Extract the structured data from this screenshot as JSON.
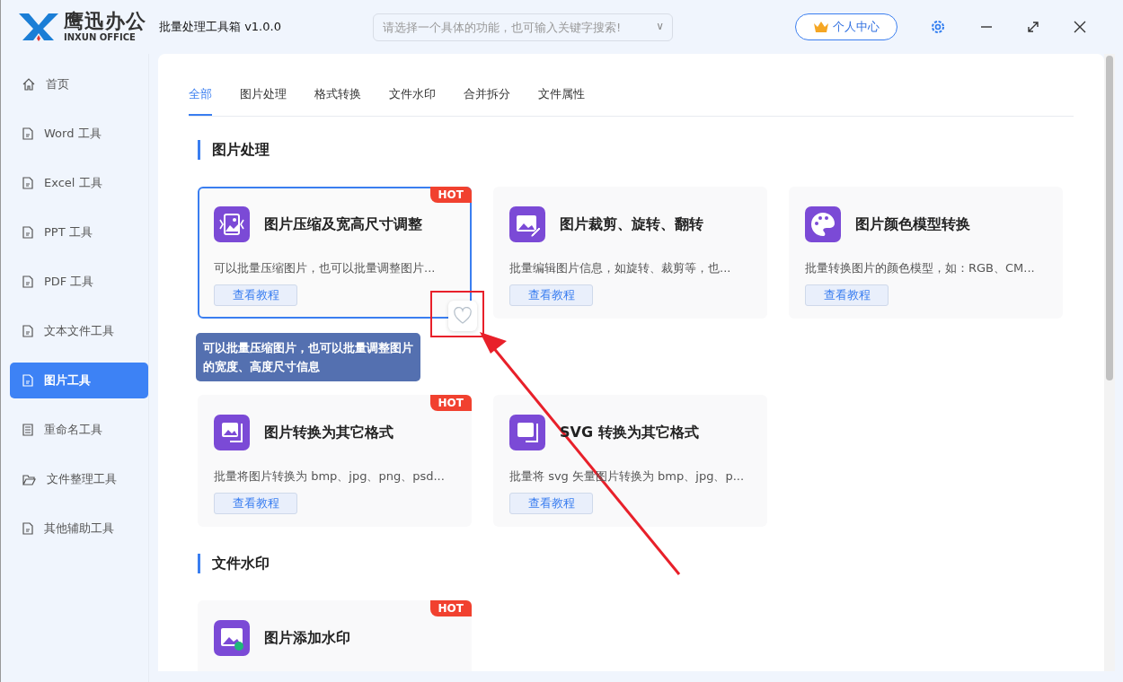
{
  "app": {
    "brand": "鹰迅办公",
    "brand_sub": "INXUN OFFICE",
    "title": "批量处理工具箱 v1.0.0"
  },
  "search": {
    "placeholder": "请选择一个具体的功能，也可输入关键字搜索!",
    "caret": "∨"
  },
  "user_button": "个人中心",
  "sidebar": {
    "items": [
      {
        "label": "首页",
        "kind": "home",
        "selected": false
      },
      {
        "label": "Word 工具",
        "kind": "file",
        "selected": false
      },
      {
        "label": "Excel 工具",
        "kind": "file",
        "selected": false
      },
      {
        "label": "PPT 工具",
        "kind": "file",
        "selected": false
      },
      {
        "label": "PDF 工具",
        "kind": "file",
        "selected": false
      },
      {
        "label": "文本文件工具",
        "kind": "file",
        "selected": false
      },
      {
        "label": "图片工具",
        "kind": "file",
        "selected": true
      },
      {
        "label": "重命名工具",
        "kind": "list",
        "selected": false
      },
      {
        "label": "文件整理工具",
        "kind": "folder",
        "selected": false
      },
      {
        "label": "其他辅助工具",
        "kind": "file",
        "selected": false
      }
    ]
  },
  "tabs": [
    {
      "label": "全部",
      "selected": true
    },
    {
      "label": "图片处理",
      "selected": false
    },
    {
      "label": "格式转换",
      "selected": false
    },
    {
      "label": "文件水印",
      "selected": false
    },
    {
      "label": "合并拆分",
      "selected": false
    },
    {
      "label": "文件属性",
      "selected": false
    }
  ],
  "sections": [
    {
      "title": "图片处理",
      "cards": [
        {
          "title": "图片压缩及宽高尺寸调整",
          "description": "可以批量压缩图片，也可以批量调整图片...",
          "link": "查看教程",
          "badge": "HOT",
          "kind": "compress",
          "hovered": true,
          "tooltip": "可以批量压缩图片，也可以批量调整图片的宽度、高度尺寸信息"
        },
        {
          "title": "图片裁剪、旋转、翻转",
          "description": "批量编辑图片信息，如旋转、裁剪等，也...",
          "link": "查看教程",
          "kind": "edit",
          "hovered": false
        },
        {
          "title": "图片颜色模型转换",
          "description": "批量转换图片的颜色模型，如：RGB、CM...",
          "link": "查看教程",
          "kind": "palette",
          "hovered": false
        },
        {
          "title": "图片转换为其它格式",
          "description": "批量将图片转换为 bmp、jpg、png、psd...",
          "link": "查看教程",
          "badge": "HOT",
          "kind": "convert",
          "hovered": false
        },
        {
          "title": "SVG 转换为其它格式",
          "description": "批量将 svg 矢量图片转换为 bmp、jpg、p...",
          "link": "查看教程",
          "kind": "convert2",
          "hovered": false
        }
      ]
    },
    {
      "title": "文件水印",
      "cards": [
        {
          "title": "图片添加水印",
          "badge": "HOT",
          "kind": "watermark",
          "hovered": false
        }
      ]
    }
  ]
}
